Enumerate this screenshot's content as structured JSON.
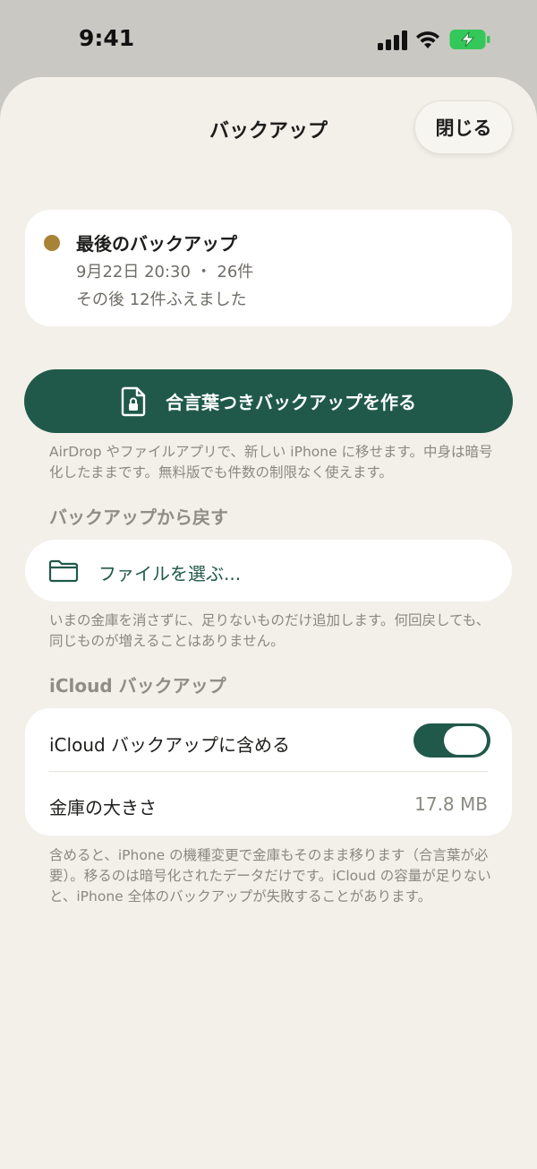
{
  "status_bar": {
    "time": "9:41"
  },
  "header": {
    "title": "バックアップ",
    "close_label": "閉じる"
  },
  "last_backup": {
    "title": "最後のバックアップ",
    "meta": "9月22日 20:30 ・ 26件",
    "since": "その後 12件ふえました",
    "dot_color": "#a88236"
  },
  "create_backup": {
    "label": "合言葉つきバックアップを作る",
    "note": "AirDrop やファイルアプリで、新しい iPhone に移せます。中身は暗号化したままです。無料版でも件数の制限なく使えます。"
  },
  "restore": {
    "header": "バックアップから戻す",
    "choose_label": "ファイルを選ぶ...",
    "note": "いまの金庫を消さずに、足りないものだけ追加します。何回戻しても、同じものが増えることはありません。"
  },
  "icloud": {
    "header": "iCloud バックアップ",
    "include_label": "iCloud バックアップに含める",
    "include_enabled": true,
    "vault_size_label": "金庫の大きさ",
    "vault_size_value": "17.8 MB",
    "note": "含めると、iPhone の機種変更で金庫もそのまま移ります（合言葉が必要）。移るのは暗号化されたデータだけです。iCloud の容量が足りないと、iPhone 全体のバックアップが失敗することがあります。"
  },
  "colors": {
    "accent": "#20594a",
    "background": "#f2f0e9",
    "card": "#ffffff"
  }
}
